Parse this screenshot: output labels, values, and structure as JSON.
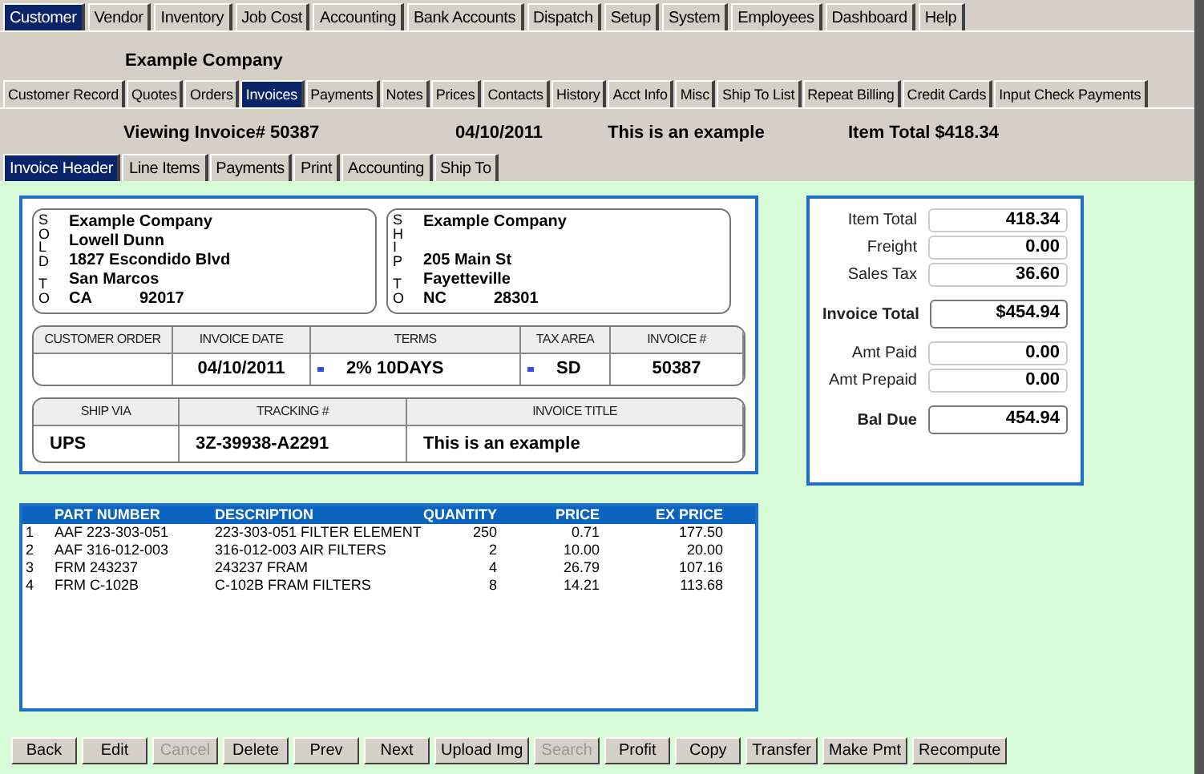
{
  "main_tabs": [
    {
      "label": "Customer",
      "selected": true
    },
    {
      "label": "Vendor",
      "selected": false
    },
    {
      "label": "Inventory",
      "selected": false
    },
    {
      "label": "Job Cost",
      "selected": false
    },
    {
      "label": "Accounting",
      "selected": false
    },
    {
      "label": "Bank Accounts",
      "selected": false
    },
    {
      "label": "Dispatch",
      "selected": false
    },
    {
      "label": "Setup",
      "selected": false
    },
    {
      "label": "System",
      "selected": false
    },
    {
      "label": "Employees",
      "selected": false
    },
    {
      "label": "Dashboard",
      "selected": false
    },
    {
      "label": "Help",
      "selected": false
    }
  ],
  "company": "Example Company",
  "customer_tabs": [
    {
      "label": "Customer Record",
      "selected": false
    },
    {
      "label": "Quotes",
      "selected": false
    },
    {
      "label": "Orders",
      "selected": false
    },
    {
      "label": "Invoices",
      "selected": true
    },
    {
      "label": "Payments",
      "selected": false
    },
    {
      "label": "Notes",
      "selected": false
    },
    {
      "label": "Prices",
      "selected": false
    },
    {
      "label": "Contacts",
      "selected": false
    },
    {
      "label": "History",
      "selected": false
    },
    {
      "label": "Acct Info",
      "selected": false
    },
    {
      "label": "Misc",
      "selected": false
    },
    {
      "label": "Ship To List",
      "selected": false
    },
    {
      "label": "Repeat Billing",
      "selected": false
    },
    {
      "label": "Credit Cards",
      "selected": false
    },
    {
      "label": "Input Check Payments",
      "selected": false
    }
  ],
  "summary": {
    "viewing": "Viewing Invoice# 50387",
    "date": "04/10/2011",
    "title": "This is an example",
    "item_total": "Item Total $418.34"
  },
  "invoice_tabs": [
    {
      "label": "Invoice Header",
      "selected": true
    },
    {
      "label": "Line Items",
      "selected": false
    },
    {
      "label": "Payments",
      "selected": false
    },
    {
      "label": "Print",
      "selected": false
    },
    {
      "label": "Accounting",
      "selected": false
    },
    {
      "label": "Ship To",
      "selected": false
    }
  ],
  "addresses": [
    {
      "label": "SOLD TO",
      "name": "Example Company",
      "contact": "Lowell Dunn",
      "street": "1827 Escondido Blvd",
      "city": "San Marcos",
      "state": "CA",
      "zip": "92017"
    },
    {
      "label": "SHIP TO",
      "name": "Example Company",
      "street": "205 Main St",
      "city": "Fayetteville",
      "state": "NC",
      "zip": "28301"
    }
  ],
  "invoice_fields": [
    {
      "label": "CUSTOMER ORDER",
      "dropdown": false
    },
    {
      "label": "INVOICE DATE",
      "value": "04/10/2011",
      "dropdown": false
    },
    {
      "label": "TERMS",
      "value": "2% 10DAYS",
      "dropdown": true
    },
    {
      "label": "TAX AREA",
      "value": "SD",
      "dropdown": true
    },
    {
      "label": "INVOICE #",
      "value": "50387",
      "dropdown": false
    }
  ],
  "shipping_fields": [
    {
      "label": "SHIP VIA",
      "value": "UPS"
    },
    {
      "label": "TRACKING #",
      "value": "3Z-39938-A2291"
    },
    {
      "label": "INVOICE TITLE",
      "value": "This is an example"
    }
  ],
  "totals": [
    {
      "label": "Item Total",
      "value": "418.34",
      "emphasis": false
    },
    {
      "label": "Freight",
      "value": "0.00",
      "emphasis": false
    },
    {
      "label": "Sales Tax",
      "value": "36.60",
      "emphasis": false
    },
    {
      "label": "Invoice Total",
      "value": "$454.94",
      "emphasis": true
    },
    {
      "label": "Amt Paid",
      "value": "0.00",
      "emphasis": false
    },
    {
      "label": "Amt Prepaid",
      "value": "0.00",
      "emphasis": false
    },
    {
      "label": "Bal Due",
      "value": "454.94",
      "emphasis": true
    }
  ],
  "line_items": {
    "columns": [
      "",
      "PART NUMBER",
      "DESCRIPTION",
      "QUANTITY",
      "PRICE",
      "EX PRICE"
    ],
    "rows": [
      [
        "1",
        "AAF 223-303-051",
        "223-303-051 FILTER ELEMENT",
        "250",
        "0.71",
        "177.50"
      ],
      [
        "2",
        "AAF 316-012-003",
        "316-012-003 AIR FILTERS",
        "2",
        "10.00",
        "20.00"
      ],
      [
        "3",
        "FRM 243237",
        "243237 FRAM",
        "4",
        "26.79",
        "107.16"
      ],
      [
        "4",
        "FRM C-102B",
        "C-102B FRAM FILTERS",
        "8",
        "14.21",
        "113.68"
      ]
    ]
  },
  "buttons": [
    {
      "label": "Back",
      "disabled": false
    },
    {
      "label": "Edit",
      "disabled": false
    },
    {
      "label": "Cancel",
      "disabled": true
    },
    {
      "label": "Delete",
      "disabled": false
    },
    {
      "label": "Prev",
      "disabled": false
    },
    {
      "label": "Next",
      "disabled": false
    },
    {
      "label": "Upload Img",
      "disabled": false
    },
    {
      "label": "Search",
      "disabled": true
    },
    {
      "label": "Profit",
      "disabled": false
    },
    {
      "label": "Copy",
      "disabled": false
    },
    {
      "label": "Transfer",
      "disabled": false
    },
    {
      "label": "Make Pmt",
      "disabled": false
    },
    {
      "label": "Recompute",
      "disabled": false
    }
  ]
}
